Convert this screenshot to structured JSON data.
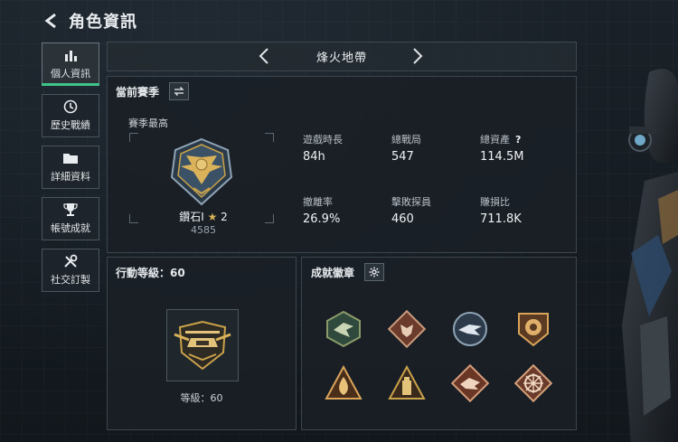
{
  "header": {
    "title": "角色資訊"
  },
  "sidebar": {
    "items": [
      {
        "label": "個人資訊",
        "icon": "bar-chart-icon",
        "active": true
      },
      {
        "label": "歷史戰績",
        "icon": "clock-icon",
        "active": false
      },
      {
        "label": "詳細資料",
        "icon": "folder-icon",
        "active": false
      },
      {
        "label": "帳號成就",
        "icon": "trophy-icon",
        "active": false
      },
      {
        "label": "社交訂製",
        "icon": "tools-icon",
        "active": false
      }
    ]
  },
  "mode": {
    "name": "烽火地帶"
  },
  "season": {
    "title": "當前賽季",
    "best_label": "賽季最高",
    "rank_name": "鑽石I",
    "rank_stars": "2",
    "rank_points": "4585",
    "stats": [
      {
        "label": "遊戲時長",
        "value": "84h"
      },
      {
        "label": "總戰局",
        "value": "547"
      },
      {
        "label": "總資產",
        "value": "114.5M",
        "help": "?"
      },
      {
        "label": "撤離率",
        "value": "26.9%"
      },
      {
        "label": "擊敗探員",
        "value": "460"
      },
      {
        "label": "賺損比",
        "value": "711.8K"
      }
    ]
  },
  "operation": {
    "title": "行動等級：60",
    "level_text": "等級：60"
  },
  "achievements": {
    "title": "成就徽章",
    "badges": [
      {
        "icon": "eagle-hexagon-badge-icon"
      },
      {
        "icon": "bull-diamond-badge-icon"
      },
      {
        "icon": "bird-circle-badge-icon"
      },
      {
        "icon": "lion-shield-badge-icon"
      },
      {
        "icon": "flame-triangle-badge-icon"
      },
      {
        "icon": "tower-triangle-badge-icon"
      },
      {
        "icon": "beast-diamond-badge-icon"
      },
      {
        "icon": "sun-diamond-badge-icon"
      }
    ]
  },
  "colors": {
    "accent": "#3fc58a",
    "gold": "#c9a24a",
    "bronze": "#a8754a"
  }
}
